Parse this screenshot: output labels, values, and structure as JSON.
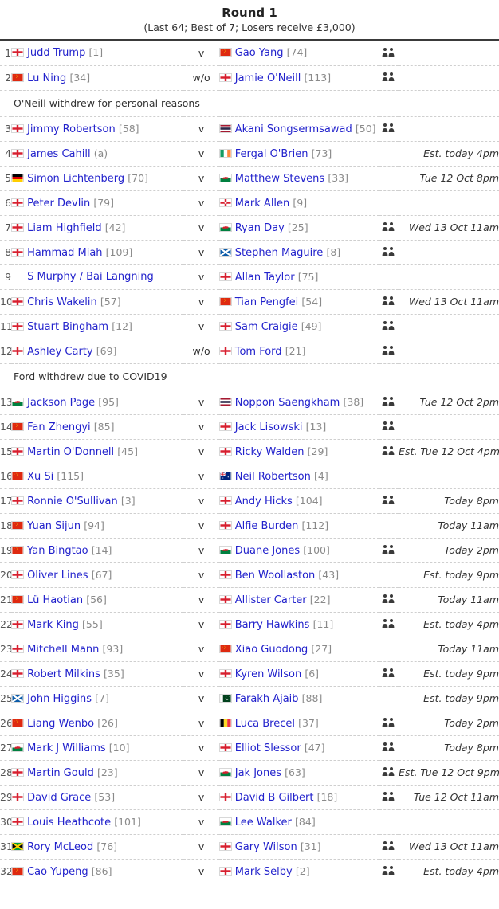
{
  "header": {
    "title": "Round 1",
    "subtitle": "(Last 64; Best of 7; Losers receive £3,000)"
  },
  "icons": {
    "session": "two-people-icon"
  },
  "colors": {
    "link": "#2222cc",
    "rank": "#8a8a8a",
    "text": "#333333",
    "rule": "#3a3a3a",
    "row_divider": "#cfcfcf"
  },
  "separators": {
    "played": "v",
    "walkover": "w/o"
  },
  "rows": [
    {
      "kind": "match",
      "num": "1",
      "p1_flag": "england",
      "p1_name": "Judd Trump",
      "p1_rank": "[1]",
      "sep": "v",
      "p2_flag": "china",
      "p2_name": "Gao Yang",
      "p2_rank": "[74]",
      "session": true,
      "time": ""
    },
    {
      "kind": "match",
      "num": "2",
      "p1_flag": "china",
      "p1_name": "Lu Ning",
      "p1_rank": "[34]",
      "sep": "w/o",
      "p2_flag": "england",
      "p2_name": "Jamie O'Neill",
      "p2_rank": "[113]",
      "session": true,
      "time": ""
    },
    {
      "kind": "note",
      "text": "O'Neill withdrew for personal reasons"
    },
    {
      "kind": "match",
      "num": "3",
      "p1_flag": "england",
      "p1_name": "Jimmy Robertson",
      "p1_rank": "[58]",
      "sep": "v",
      "p2_flag": "thailand",
      "p2_name": "Akani Songsermsawad",
      "p2_rank": "[50]",
      "session": true,
      "time": ""
    },
    {
      "kind": "match",
      "num": "4",
      "p1_flag": "england",
      "p1_name": "James Cahill",
      "p1_rank": "(a)",
      "sep": "v",
      "p2_flag": "ireland",
      "p2_name": "Fergal O'Brien",
      "p2_rank": "[73]",
      "session": false,
      "time": "Est. today 4pm"
    },
    {
      "kind": "match",
      "num": "5",
      "p1_flag": "germany",
      "p1_name": "Simon Lichtenberg",
      "p1_rank": "[70]",
      "sep": "v",
      "p2_flag": "wales",
      "p2_name": "Matthew Stevens",
      "p2_rank": "[33]",
      "session": false,
      "time": "Tue 12 Oct 8pm"
    },
    {
      "kind": "match",
      "num": "6",
      "p1_flag": "england",
      "p1_name": "Peter Devlin",
      "p1_rank": "[79]",
      "sep": "v",
      "p2_flag": "northern-ireland",
      "p2_name": "Mark Allen",
      "p2_rank": "[9]",
      "session": false,
      "time": ""
    },
    {
      "kind": "match",
      "num": "7",
      "p1_flag": "england",
      "p1_name": "Liam Highfield",
      "p1_rank": "[42]",
      "sep": "v",
      "p2_flag": "wales",
      "p2_name": "Ryan Day",
      "p2_rank": "[25]",
      "session": true,
      "time": "Wed 13 Oct 11am"
    },
    {
      "kind": "match",
      "num": "8",
      "p1_flag": "england",
      "p1_name": "Hammad Miah",
      "p1_rank": "[109]",
      "sep": "v",
      "p2_flag": "scotland",
      "p2_name": "Stephen Maguire",
      "p2_rank": "[8]",
      "session": true,
      "time": ""
    },
    {
      "kind": "match",
      "num": "9",
      "p1_flag": "none",
      "p1_name": "S Murphy / Bai Langning",
      "p1_rank": "",
      "sep": "v",
      "p2_flag": "england",
      "p2_name": "Allan Taylor",
      "p2_rank": "[75]",
      "session": false,
      "time": ""
    },
    {
      "kind": "match",
      "num": "10",
      "p1_flag": "england",
      "p1_name": "Chris Wakelin",
      "p1_rank": "[57]",
      "sep": "v",
      "p2_flag": "china",
      "p2_name": "Tian Pengfei",
      "p2_rank": "[54]",
      "session": true,
      "time": "Wed 13 Oct 11am"
    },
    {
      "kind": "match",
      "num": "11",
      "p1_flag": "england",
      "p1_name": "Stuart Bingham",
      "p1_rank": "[12]",
      "sep": "v",
      "p2_flag": "england",
      "p2_name": "Sam Craigie",
      "p2_rank": "[49]",
      "session": true,
      "time": ""
    },
    {
      "kind": "match",
      "num": "12",
      "p1_flag": "england",
      "p1_name": "Ashley Carty",
      "p1_rank": "[69]",
      "sep": "w/o",
      "p2_flag": "england",
      "p2_name": "Tom Ford",
      "p2_rank": "[21]",
      "session": true,
      "time": ""
    },
    {
      "kind": "note",
      "text": "Ford withdrew due to COVID19"
    },
    {
      "kind": "match",
      "num": "13",
      "p1_flag": "wales",
      "p1_name": "Jackson Page",
      "p1_rank": "[95]",
      "sep": "v",
      "p2_flag": "thailand",
      "p2_name": "Noppon Saengkham",
      "p2_rank": "[38]",
      "session": true,
      "time": "Tue 12 Oct 2pm"
    },
    {
      "kind": "match",
      "num": "14",
      "p1_flag": "china",
      "p1_name": "Fan Zhengyi",
      "p1_rank": "[85]",
      "sep": "v",
      "p2_flag": "england",
      "p2_name": "Jack Lisowski",
      "p2_rank": "[13]",
      "session": true,
      "time": ""
    },
    {
      "kind": "match",
      "num": "15",
      "p1_flag": "england",
      "p1_name": "Martin O'Donnell",
      "p1_rank": "[45]",
      "sep": "v",
      "p2_flag": "england",
      "p2_name": "Ricky Walden",
      "p2_rank": "[29]",
      "session": true,
      "time": "Est. Tue 12 Oct 4pm"
    },
    {
      "kind": "match",
      "num": "16",
      "p1_flag": "china",
      "p1_name": "Xu Si",
      "p1_rank": "[115]",
      "sep": "v",
      "p2_flag": "australia",
      "p2_name": "Neil Robertson",
      "p2_rank": "[4]",
      "session": false,
      "time": ""
    },
    {
      "kind": "match",
      "num": "17",
      "p1_flag": "england",
      "p1_name": "Ronnie O'Sullivan",
      "p1_rank": "[3]",
      "sep": "v",
      "p2_flag": "england",
      "p2_name": "Andy Hicks",
      "p2_rank": "[104]",
      "session": true,
      "time": "Today 8pm"
    },
    {
      "kind": "match",
      "num": "18",
      "p1_flag": "china",
      "p1_name": "Yuan Sijun",
      "p1_rank": "[94]",
      "sep": "v",
      "p2_flag": "england",
      "p2_name": "Alfie Burden",
      "p2_rank": "[112]",
      "session": false,
      "time": "Today 11am"
    },
    {
      "kind": "match",
      "num": "19",
      "p1_flag": "china",
      "p1_name": "Yan Bingtao",
      "p1_rank": "[14]",
      "sep": "v",
      "p2_flag": "wales",
      "p2_name": "Duane Jones",
      "p2_rank": "[100]",
      "session": true,
      "time": "Today 2pm"
    },
    {
      "kind": "match",
      "num": "20",
      "p1_flag": "england",
      "p1_name": "Oliver Lines",
      "p1_rank": "[67]",
      "sep": "v",
      "p2_flag": "england",
      "p2_name": "Ben Woollaston",
      "p2_rank": "[43]",
      "session": false,
      "time": "Est. today 9pm"
    },
    {
      "kind": "match",
      "num": "21",
      "p1_flag": "china",
      "p1_name": "Lü Haotian",
      "p1_rank": "[56]",
      "sep": "v",
      "p2_flag": "england",
      "p2_name": "Allister Carter",
      "p2_rank": "[22]",
      "session": true,
      "time": "Today 11am"
    },
    {
      "kind": "match",
      "num": "22",
      "p1_flag": "england",
      "p1_name": "Mark King",
      "p1_rank": "[55]",
      "sep": "v",
      "p2_flag": "england",
      "p2_name": "Barry Hawkins",
      "p2_rank": "[11]",
      "session": true,
      "time": "Est. today 4pm"
    },
    {
      "kind": "match",
      "num": "23",
      "p1_flag": "england",
      "p1_name": "Mitchell Mann",
      "p1_rank": "[93]",
      "sep": "v",
      "p2_flag": "china",
      "p2_name": "Xiao Guodong",
      "p2_rank": "[27]",
      "session": false,
      "time": "Today 11am"
    },
    {
      "kind": "match",
      "num": "24",
      "p1_flag": "england",
      "p1_name": "Robert Milkins",
      "p1_rank": "[35]",
      "sep": "v",
      "p2_flag": "england",
      "p2_name": "Kyren Wilson",
      "p2_rank": "[6]",
      "session": true,
      "time": "Est. today 9pm"
    },
    {
      "kind": "match",
      "num": "25",
      "p1_flag": "scotland",
      "p1_name": "John Higgins",
      "p1_rank": "[7]",
      "sep": "v",
      "p2_flag": "pakistan",
      "p2_name": "Farakh Ajaib",
      "p2_rank": "[88]",
      "session": false,
      "time": "Est. today 9pm"
    },
    {
      "kind": "match",
      "num": "26",
      "p1_flag": "china",
      "p1_name": "Liang Wenbo",
      "p1_rank": "[26]",
      "sep": "v",
      "p2_flag": "belgium",
      "p2_name": "Luca Brecel",
      "p2_rank": "[37]",
      "session": true,
      "time": "Today 2pm"
    },
    {
      "kind": "match",
      "num": "27",
      "p1_flag": "wales",
      "p1_name": "Mark J Williams",
      "p1_rank": "[10]",
      "sep": "v",
      "p2_flag": "england",
      "p2_name": "Elliot Slessor",
      "p2_rank": "[47]",
      "session": true,
      "time": "Today 8pm"
    },
    {
      "kind": "match",
      "num": "28",
      "p1_flag": "england",
      "p1_name": "Martin Gould",
      "p1_rank": "[23]",
      "sep": "v",
      "p2_flag": "wales",
      "p2_name": "Jak Jones",
      "p2_rank": "[63]",
      "session": true,
      "time": "Est. Tue 12 Oct 9pm"
    },
    {
      "kind": "match",
      "num": "29",
      "p1_flag": "england",
      "p1_name": "David Grace",
      "p1_rank": "[53]",
      "sep": "v",
      "p2_flag": "england",
      "p2_name": "David B Gilbert",
      "p2_rank": "[18]",
      "session": true,
      "time": "Tue 12 Oct 11am"
    },
    {
      "kind": "match",
      "num": "30",
      "p1_flag": "england",
      "p1_name": "Louis Heathcote",
      "p1_rank": "[101]",
      "sep": "v",
      "p2_flag": "wales",
      "p2_name": "Lee Walker",
      "p2_rank": "[84]",
      "session": false,
      "time": ""
    },
    {
      "kind": "match",
      "num": "31",
      "p1_flag": "jamaica",
      "p1_name": "Rory McLeod",
      "p1_rank": "[76]",
      "sep": "v",
      "p2_flag": "england",
      "p2_name": "Gary Wilson",
      "p2_rank": "[31]",
      "session": true,
      "time": "Wed 13 Oct 11am"
    },
    {
      "kind": "match",
      "num": "32",
      "p1_flag": "china",
      "p1_name": "Cao Yupeng",
      "p1_rank": "[86]",
      "sep": "v",
      "p2_flag": "england",
      "p2_name": "Mark Selby",
      "p2_rank": "[2]",
      "session": true,
      "time": "Est. today 4pm"
    }
  ]
}
